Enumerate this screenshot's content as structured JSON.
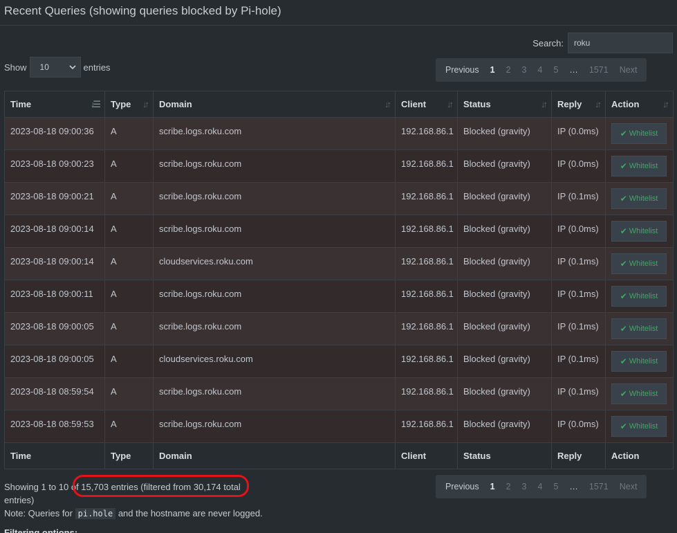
{
  "header": {
    "title": "Recent Queries (showing queries blocked by Pi-hole)"
  },
  "search": {
    "label": "Search:",
    "value": "roku"
  },
  "length": {
    "show": "Show",
    "value": "10",
    "entries": "entries"
  },
  "pagination": {
    "previous": "Previous",
    "next": "Next",
    "ellipsis": "…",
    "pages": [
      "1",
      "2",
      "3",
      "4",
      "5"
    ],
    "last": "1571"
  },
  "columns": [
    "Time",
    "Type",
    "Domain",
    "Client",
    "Status",
    "Reply",
    "Action"
  ],
  "rows": [
    {
      "time": "2023-08-18 09:00:36",
      "type": "A",
      "domain": "scribe.logs.roku.com",
      "client": "192.168.86.1",
      "status": "Blocked (gravity)",
      "reply": "IP (0.0ms)",
      "action": "Whitelist"
    },
    {
      "time": "2023-08-18 09:00:23",
      "type": "A",
      "domain": "scribe.logs.roku.com",
      "client": "192.168.86.1",
      "status": "Blocked (gravity)",
      "reply": "IP (0.0ms)",
      "action": "Whitelist"
    },
    {
      "time": "2023-08-18 09:00:21",
      "type": "A",
      "domain": "scribe.logs.roku.com",
      "client": "192.168.86.1",
      "status": "Blocked (gravity)",
      "reply": "IP (0.1ms)",
      "action": "Whitelist"
    },
    {
      "time": "2023-08-18 09:00:14",
      "type": "A",
      "domain": "scribe.logs.roku.com",
      "client": "192.168.86.1",
      "status": "Blocked (gravity)",
      "reply": "IP (0.0ms)",
      "action": "Whitelist"
    },
    {
      "time": "2023-08-18 09:00:14",
      "type": "A",
      "domain": "cloudservices.roku.com",
      "client": "192.168.86.1",
      "status": "Blocked (gravity)",
      "reply": "IP (0.1ms)",
      "action": "Whitelist"
    },
    {
      "time": "2023-08-18 09:00:11",
      "type": "A",
      "domain": "scribe.logs.roku.com",
      "client": "192.168.86.1",
      "status": "Blocked (gravity)",
      "reply": "IP (0.1ms)",
      "action": "Whitelist"
    },
    {
      "time": "2023-08-18 09:00:05",
      "type": "A",
      "domain": "scribe.logs.roku.com",
      "client": "192.168.86.1",
      "status": "Blocked (gravity)",
      "reply": "IP (0.1ms)",
      "action": "Whitelist"
    },
    {
      "time": "2023-08-18 09:00:05",
      "type": "A",
      "domain": "cloudservices.roku.com",
      "client": "192.168.86.1",
      "status": "Blocked (gravity)",
      "reply": "IP (0.1ms)",
      "action": "Whitelist"
    },
    {
      "time": "2023-08-18 08:59:54",
      "type": "A",
      "domain": "scribe.logs.roku.com",
      "client": "192.168.86.1",
      "status": "Blocked (gravity)",
      "reply": "IP (0.1ms)",
      "action": "Whitelist"
    },
    {
      "time": "2023-08-18 08:59:53",
      "type": "A",
      "domain": "scribe.logs.roku.com",
      "client": "192.168.86.1",
      "status": "Blocked (gravity)",
      "reply": "IP (0.0ms)",
      "action": "Whitelist"
    }
  ],
  "info": {
    "text": "Showing 1 to 10 of 15,703 entries (filtered from 30,174 total entries)"
  },
  "note": {
    "prefix": "Note: Queries for",
    "code": "pi.hole",
    "suffix": "and the hostname are never logged."
  },
  "filtering": {
    "title": "Filtering options:"
  },
  "colors": {
    "background": "#272c30",
    "blocked": "#b83b35",
    "whitelist": "#3fa864",
    "annotation": "#e0141a"
  },
  "icons": {
    "sort": "sort-icon",
    "check": "check-icon",
    "dropdown": "chevron-down-icon"
  }
}
